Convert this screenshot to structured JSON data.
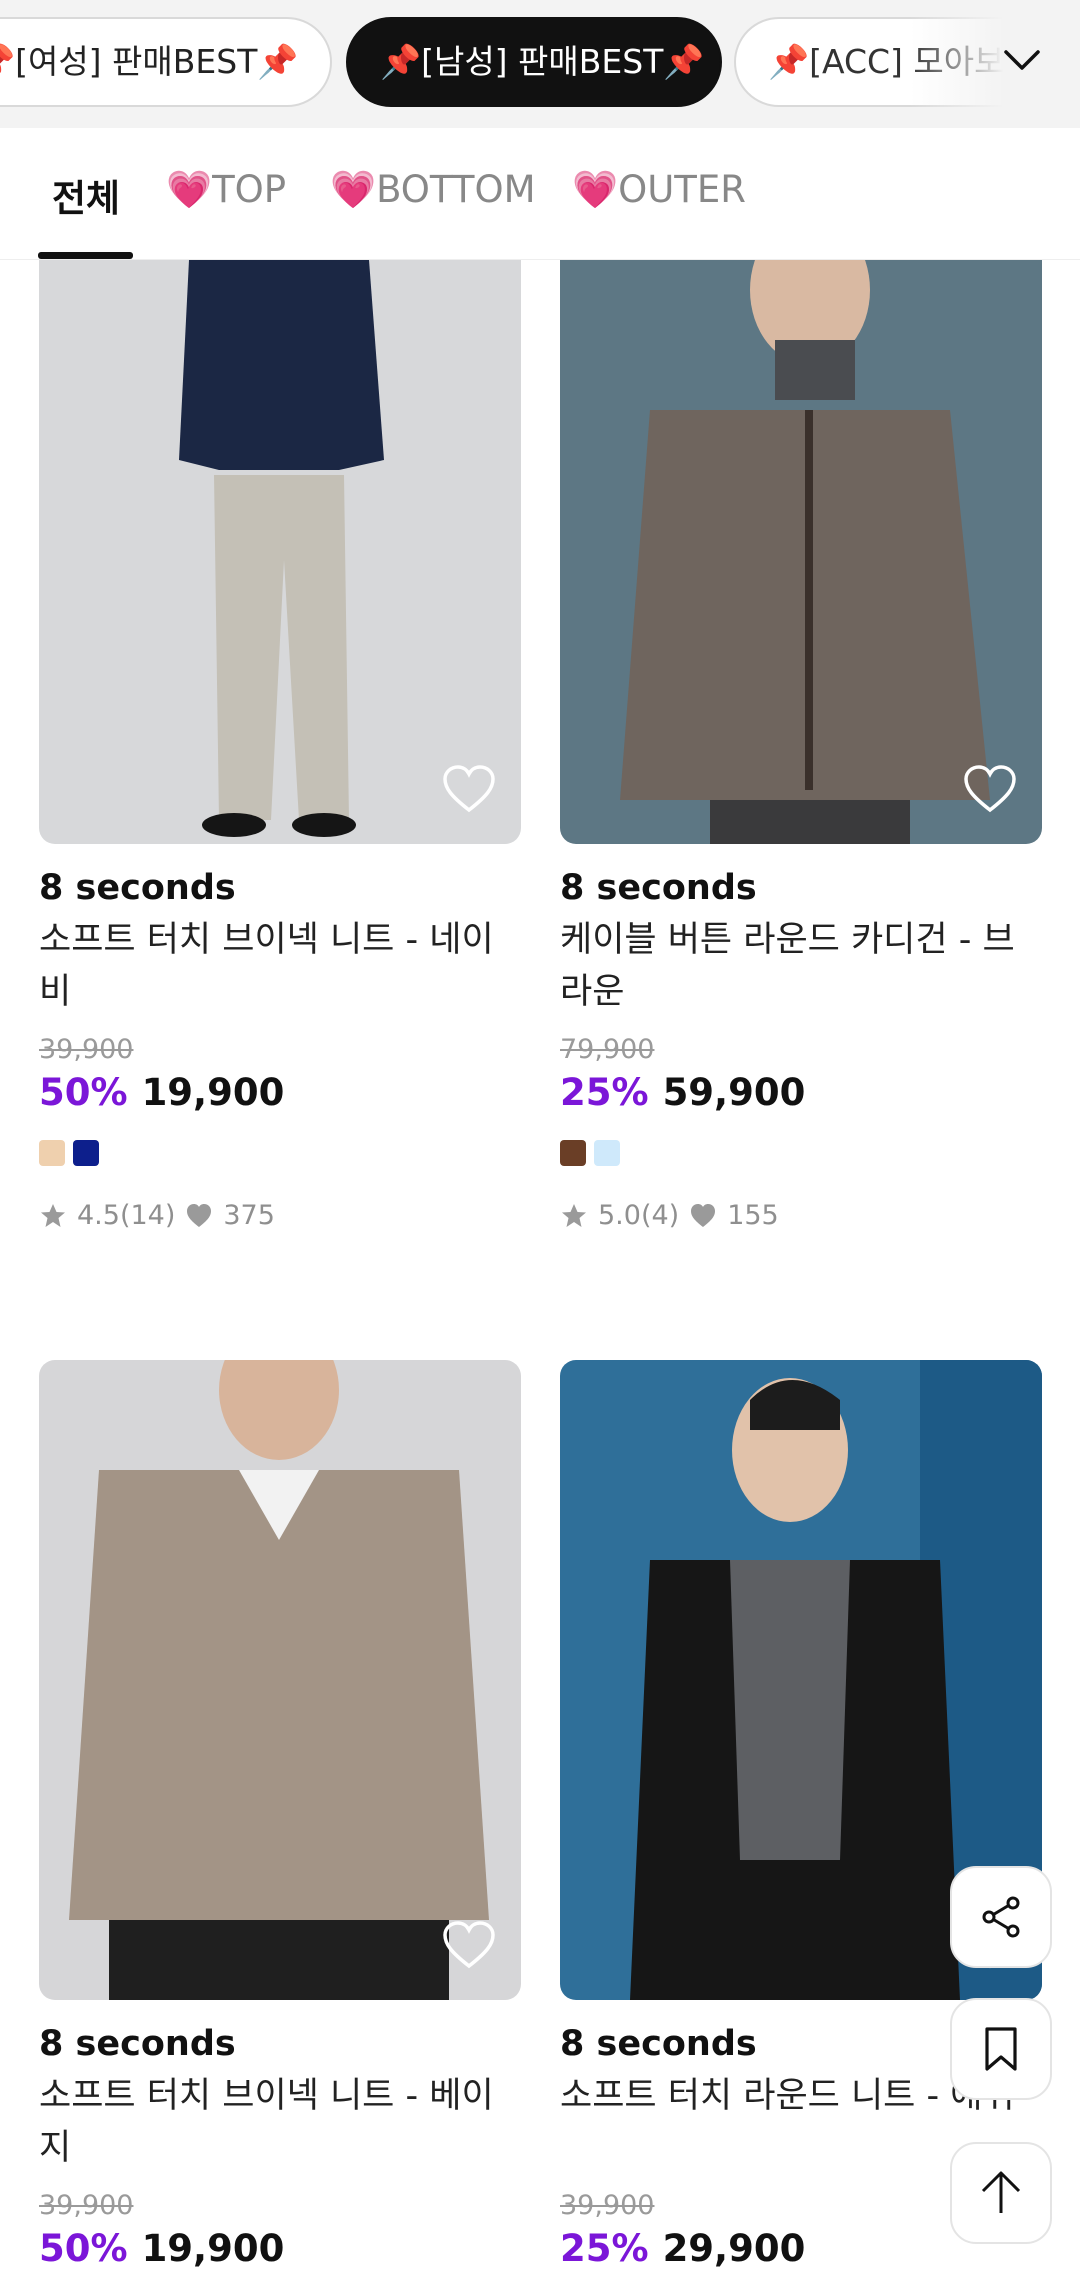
{
  "chips": [
    {
      "label": "📌[여성] 판매BEST📌",
      "active": false
    },
    {
      "label": "📌[남성] 판매BEST📌",
      "active": true
    },
    {
      "label": "📌[ACC] 모아보기📌",
      "active": false
    }
  ],
  "tabs": [
    {
      "label": "전체",
      "active": true
    },
    {
      "label": "💗TOP",
      "active": false
    },
    {
      "label": "💗BOTTOM",
      "active": false
    },
    {
      "label": "💗OUTER",
      "active": false
    }
  ],
  "products": [
    {
      "brand": "8 seconds",
      "name": "소프트 터치 브이넥 니트 - 네이비",
      "original_price": "39,900",
      "discount": "50%",
      "price": "19,900",
      "swatches": [
        "#efd0ae",
        "#0d1f8c"
      ],
      "rating": "4.5(14)",
      "likes": "375"
    },
    {
      "brand": "8 seconds",
      "name": "케이블 버튼 라운드 카디건 - 브라운",
      "original_price": "79,900",
      "discount": "25%",
      "price": "59,900",
      "swatches": [
        "#6a3e26",
        "#cfe9fb"
      ],
      "rating": "5.0(4)",
      "likes": "155"
    },
    {
      "brand": "8 seconds",
      "name": "소프트 터치 브이넥 니트 - 베이지",
      "original_price": "39,900",
      "discount": "50%",
      "price": "19,900"
    },
    {
      "brand": "8 seconds",
      "name": "소프트 터치 라운드 니트 - 애쉬",
      "original_price": "39,900",
      "discount": "25%",
      "price": "29,900"
    }
  ],
  "colors": {
    "accent": "#7b16d8",
    "chip_active": "#111111"
  },
  "icons": {
    "share": "share-icon",
    "bookmark": "bookmark-icon",
    "scroll_top": "arrow-up-icon",
    "wishlist": "heart-outline-icon"
  }
}
